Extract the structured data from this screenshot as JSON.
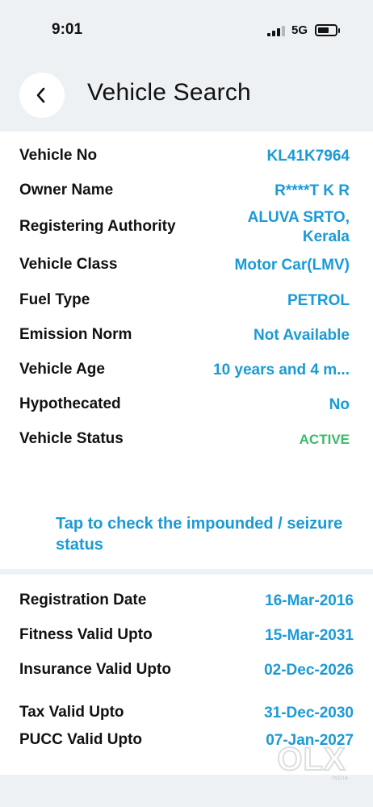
{
  "status_bar": {
    "time": "9:01",
    "network": "5G",
    "battery_level": 0.65
  },
  "header": {
    "back_icon": "chevron-left-icon",
    "title": "Vehicle Search"
  },
  "vehicle_details": [
    {
      "label": "Vehicle No",
      "value": "KL41K7964"
    },
    {
      "label": "Owner Name",
      "value": "R****T K R"
    },
    {
      "label": "Registering Authority",
      "value": "ALUVA SRTO, Kerala"
    },
    {
      "label": "Vehicle Class",
      "value": "Motor Car(LMV)"
    },
    {
      "label": "Fuel Type",
      "value": "PETROL"
    },
    {
      "label": "Emission Norm",
      "value": "Not Available"
    },
    {
      "label": "Vehicle Age",
      "value": "10 years and 4 m..."
    },
    {
      "label": "Hypothecated",
      "value": "No"
    },
    {
      "label": "Vehicle Status",
      "value": "ACTIVE"
    }
  ],
  "impound_link": "Tap to check the impounded / seizure status",
  "validity_details": [
    {
      "label": "Registration Date",
      "value": "16-Mar-2016"
    },
    {
      "label": "Fitness Valid Upto",
      "value": "15-Mar-2031"
    },
    {
      "label": "Insurance Valid Upto",
      "value": "02-Dec-2026"
    },
    {
      "label": "Tax Valid Upto",
      "value": "31-Dec-2030"
    },
    {
      "label": "PUCC Valid Upto",
      "value": "07-Jan-2027"
    }
  ],
  "watermark": {
    "logo": "OLX",
    "caption": "INDIA"
  },
  "colors": {
    "accent": "#1a9ad7",
    "active_status": "#3cb96a",
    "background": "#eef1f4"
  }
}
